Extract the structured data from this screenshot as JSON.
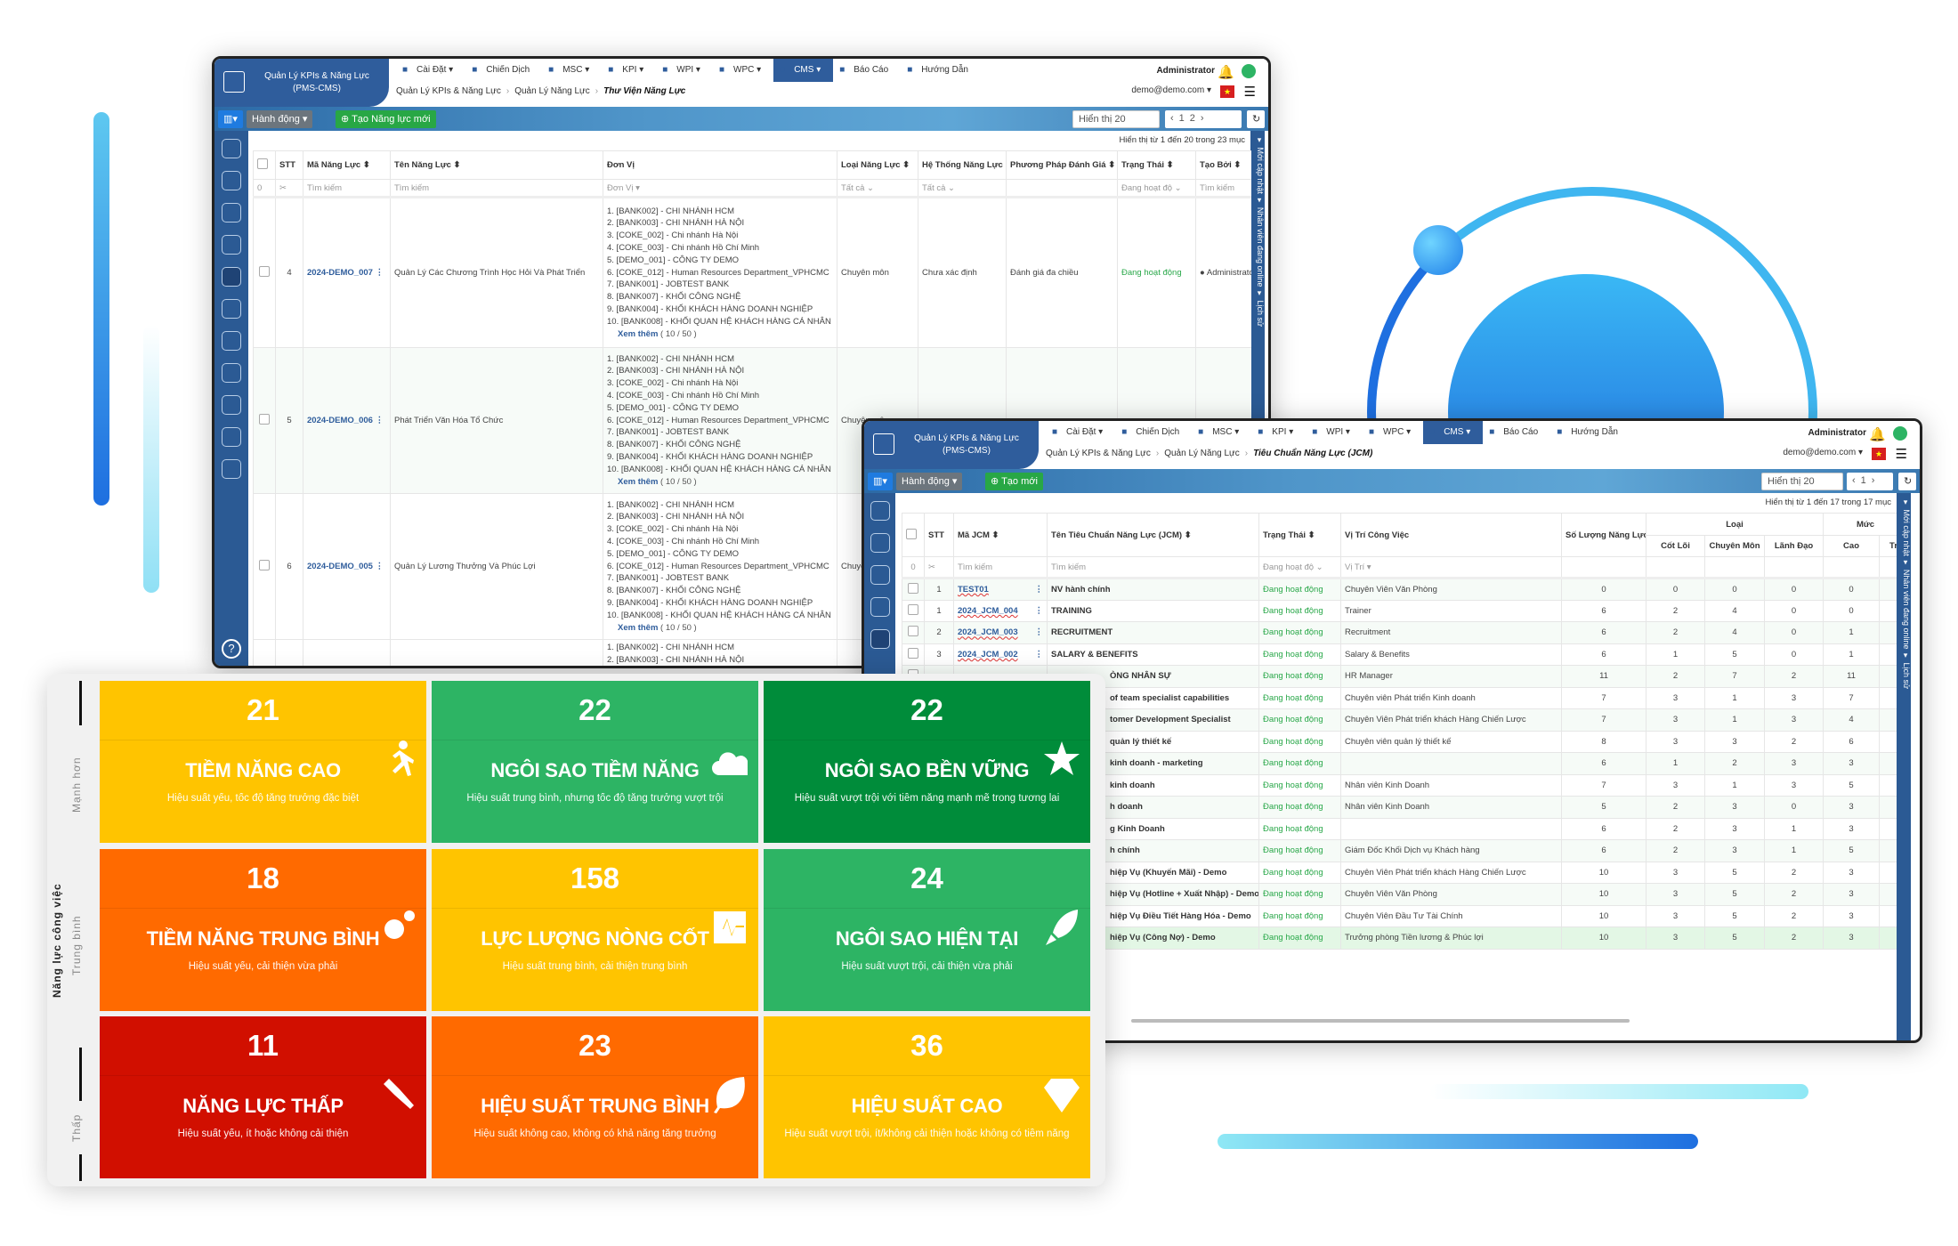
{
  "colors": {
    "brand": "#2f5d9c",
    "active_status": "#2aa84a",
    "yellow": "#ffc400",
    "green": "#2db464",
    "dark_green": "#008c3a",
    "orange": "#ff6a00",
    "red": "#d10f00"
  },
  "app": {
    "brand_line1": "Quản Lý KPIs & Năng Lực",
    "brand_line2": "(PMS-CMS)",
    "menu": [
      {
        "icon": "gear-icon",
        "label": "Cài Đặt ▾"
      },
      {
        "icon": "flag-icon",
        "label": "Chiến Dịch"
      },
      {
        "icon": "file-icon",
        "label": "MSC ▾"
      },
      {
        "icon": "chart-icon",
        "label": "KPI ▾"
      },
      {
        "icon": "tree-icon",
        "label": "WPI ▾"
      },
      {
        "icon": "search-icon",
        "label": "WPC ▾"
      },
      {
        "icon": "trend-icon",
        "label": "CMS ▾"
      },
      {
        "icon": "report-icon",
        "label": "Báo Cáo"
      },
      {
        "icon": "book-icon",
        "label": "Hướng Dẫn"
      }
    ],
    "user": "Administrator",
    "email": "demo@demo.com ▾",
    "flag": "★"
  },
  "back": {
    "breadcrumb": [
      "Quản Lý KPIs & Năng Lực",
      "Quản Lý Năng Lực",
      "Thư Viện Năng Lực"
    ],
    "actions": "Hành động ▾",
    "create": "Tạo Năng lực mới",
    "page_size": "Hiển thị 20",
    "pages": [
      "‹",
      "1",
      "2",
      "›"
    ],
    "info": "Hiển thị từ 1 đến 20 trong 23 mục",
    "side_tabs": "▾ Mới cập nhật   ▾ Nhân viên đang online   ▾ Lịch sử",
    "columns": [
      "",
      "STT",
      "Mã Năng Lực ⬍",
      "Tên Năng Lực ⬍",
      "Đơn Vị",
      "Loại Năng Lực ⬍",
      "Hệ Thống Năng Lực",
      "Phương Pháp Đánh Giá ⬍",
      "Trạng Thái ⬍",
      "Tạo Bởi ⬍"
    ],
    "filters": [
      "0",
      "",
      "Tìm kiếm",
      "Tìm kiếm",
      "Đơn Vị ▾",
      "Tất cả ⌄",
      "Tất cả ⌄",
      "",
      "Đang hoạt độ ⌄",
      "Tìm kiếm"
    ],
    "units": [
      "1. [BANK002] - CHI NHÁNH HCM",
      "2. [BANK003] - CHI NHÁNH HÀ NỘI",
      "3. [COKE_002] - Chi nhánh Hà Nội",
      "4. [COKE_003] - Chi nhánh Hồ Chí Minh",
      "5. [DEMO_001] - CÔNG TY DEMO",
      "6. [COKE_012] - Human Resources Department_VPHCMC",
      "7. [BANK001] - JOBTEST BANK",
      "8. [BANK007] - KHỐI CÔNG NGHỆ",
      "9. [BANK004] - KHỐI KHÁCH HÀNG DOANH NGHIỆP",
      "10. [BANK008] - KHỐI QUAN HỆ KHÁCH HÀNG CÁ NHÂN"
    ],
    "see_more": "Xem thêm",
    "see_more_count": "( 10 / 50 )",
    "rows": [
      {
        "stt": "4",
        "code": "2024-DEMO_007",
        "name": "Quản Lý Các Chương Trình Học Hỏi Và Phát Triển",
        "type": "Chuyên môn",
        "system": "Chưa xác định",
        "method": "Đánh giá đa chiều",
        "status": "Đang hoạt động",
        "creator": "Administrator"
      },
      {
        "stt": "5",
        "code": "2024-DEMO_006",
        "name": "Phát Triển Văn Hóa Tổ Chức",
        "type": "Chuyên môn"
      },
      {
        "stt": "6",
        "code": "2024-DEMO_005",
        "name": "Quản Lý Lương Thưởng Và Phúc Lợi",
        "type": "Chuyên môn"
      }
    ]
  },
  "front": {
    "breadcrumb": [
      "Quản Lý KPIs & Năng Lực",
      "Quản Lý Năng Lực",
      "Tiêu Chuẩn Năng Lực (JCM)"
    ],
    "actions": "Hành động ▾",
    "create": "Tạo mới",
    "page_size": "Hiển thị 20",
    "pages": [
      "‹",
      "1",
      "›"
    ],
    "info": "Hiển thị từ 1 đến 17 trong 17 mục",
    "side_tabs": "▾ Mới cập nhật   ▾ Nhân viên đang online   ▾ Lịch sử",
    "columns": {
      "stt": "STT",
      "code": "Mã JCM ⬍",
      "name": "Tên Tiêu Chuẩn Năng Lực (JCM) ⬍",
      "status": "Trạng Thái ⬍",
      "position": "Vị Trí Công Việc",
      "count": "Số Lượng Năng Lực",
      "group_type": "Loại",
      "group_level": "Mức",
      "core": "Cốt Lõi",
      "expert": "Chuyên Môn",
      "lead": "Lãnh Đạo",
      "high": "Cao",
      "next": "Tr"
    },
    "filters": {
      "count": "0",
      "code": "Tìm kiếm",
      "name": "Tìm kiếm",
      "status": "Đang hoạt độ ⌄",
      "position": "Vị Trí ▾"
    },
    "rows": [
      {
        "stt": "1",
        "code": "TEST01",
        "name": "NV hành chính",
        "status": "Đang hoạt động",
        "position": "Chuyên Viên Văn Phòng",
        "v": [
          "0",
          "0",
          "0",
          "0",
          "0"
        ]
      },
      {
        "stt": "1",
        "code": "2024_JCM_004",
        "name": "TRAINING",
        "status": "Đang hoạt động",
        "position": "Trainer",
        "v": [
          "6",
          "2",
          "4",
          "0",
          "0"
        ]
      },
      {
        "stt": "2",
        "code": "2024_JCM_003",
        "name": "RECRUITMENT",
        "status": "Đang hoạt động",
        "position": "Recruitment",
        "v": [
          "6",
          "2",
          "4",
          "0",
          "1"
        ]
      },
      {
        "stt": "3",
        "code": "2024_JCM_002",
        "name": "SALARY & BENEFITS",
        "status": "Đang hoạt động",
        "position": "Salary & Benefits",
        "v": [
          "6",
          "1",
          "5",
          "0",
          "1"
        ]
      },
      {
        "name": "ÒNG NHÂN SỰ",
        "status": "Đang hoạt động",
        "position": "HR Manager",
        "v": [
          "11",
          "2",
          "7",
          "2",
          "11"
        ]
      },
      {
        "name": "of team specialist capabilities",
        "status": "Đang hoạt động",
        "position": "Chuyên viên Phát triển Kinh doanh",
        "v": [
          "7",
          "3",
          "1",
          "3",
          "7"
        ]
      },
      {
        "name": "tomer Development Specialist",
        "status": "Đang hoạt động",
        "position": "Chuyên Viên Phát triển khách Hàng Chiến Lược",
        "v": [
          "7",
          "3",
          "1",
          "3",
          "4"
        ]
      },
      {
        "name": "quản lý thiết kế",
        "status": "Đang hoạt động",
        "position": "Chuyên viên quản lý thiết kế",
        "v": [
          "8",
          "3",
          "3",
          "2",
          "6"
        ]
      },
      {
        "name": "kinh doanh - marketing",
        "status": "Đang hoạt động",
        "position": "",
        "v": [
          "6",
          "1",
          "2",
          "3",
          "3"
        ]
      },
      {
        "name": "kinh doanh",
        "status": "Đang hoạt động",
        "position": "Nhân viên Kinh Doanh",
        "v": [
          "7",
          "3",
          "1",
          "3",
          "5"
        ]
      },
      {
        "name": "h doanh",
        "status": "Đang hoạt động",
        "position": "Nhân viên Kinh Doanh",
        "v": [
          "5",
          "2",
          "3",
          "0",
          "3"
        ]
      },
      {
        "name": "g Kinh Doanh",
        "status": "Đang hoạt động",
        "position": "",
        "v": [
          "6",
          "2",
          "3",
          "1",
          "3"
        ]
      },
      {
        "name": "h chính",
        "status": "Đang hoạt động",
        "position": "Giám Đốc Khối Dịch vụ Khách hàng",
        "v": [
          "6",
          "2",
          "3",
          "1",
          "5"
        ]
      },
      {
        "name": "hiệp Vụ (Khuyến Mãi) - Demo",
        "status": "Đang hoạt động",
        "position": "Chuyên Viên Phát triển khách Hàng Chiến Lược",
        "v": [
          "10",
          "3",
          "5",
          "2",
          "3"
        ]
      },
      {
        "name": "hiệp Vụ (Hotline + Xuất Nhập) - Demo",
        "status": "Đang hoạt động",
        "position": "Chuyên Viên Văn Phòng",
        "v": [
          "10",
          "3",
          "5",
          "2",
          "3"
        ]
      },
      {
        "name": "hiệp Vụ Điều Tiết Hàng Hóa - Demo",
        "status": "Đang hoạt động",
        "position": "Chuyên Viên Đầu Tư Tài Chính",
        "v": [
          "10",
          "3",
          "5",
          "2",
          "3"
        ]
      },
      {
        "name": "hiệp Vụ (Công Nợ) - Demo",
        "status": "Đang hoạt động",
        "position": "Trưởng phòng Tiền lương & Phúc lợi",
        "v": [
          "10",
          "3",
          "5",
          "2",
          "3"
        ],
        "highlight": true
      }
    ]
  },
  "ninebox": {
    "y_axis_title": "Năng lực công việc",
    "y_levels": [
      "Mạnh hơn",
      "Trung bình",
      "Thấp"
    ],
    "cells": [
      {
        "count": "21",
        "title": "TIỀM NĂNG CAO",
        "desc": "Hiệu suất yếu, tốc độ tăng trưởng đặc biệt",
        "color": "#ffc400",
        "icon": "running-icon"
      },
      {
        "count": "22",
        "title": "NGÔI SAO TIỀM NĂNG",
        "desc": "Hiệu suất trung bình, nhưng tốc độ tăng trưởng vượt trội",
        "color": "#2db464",
        "icon": "cloud-icon"
      },
      {
        "count": "22",
        "title": "NGÔI SAO BỀN VỮNG",
        "desc": "Hiệu suất vượt trội với tiềm năng mạnh mẽ trong tương lai",
        "color": "#008c3a",
        "icon": "star-icon"
      },
      {
        "count": "18",
        "title": "TIỀM NĂNG TRUNG BÌNH",
        "desc": "Hiệu suất yếu, cải thiện vừa phải",
        "color": "#ff6a00",
        "icon": "gears-icon"
      },
      {
        "count": "158",
        "title": "LỰC LƯỢNG NÒNG CỐT",
        "desc": "Hiệu suất trung bình, cải thiện trung bình",
        "color": "#ffc400",
        "icon": "heartbeat-icon"
      },
      {
        "count": "24",
        "title": "NGÔI SAO HIỆN TẠI",
        "desc": "Hiệu suất vượt trội, cải thiện vừa phải",
        "color": "#2db464",
        "icon": "rocket-icon"
      },
      {
        "count": "11",
        "title": "NĂNG LỰC THẤP",
        "desc": "Hiệu suất yếu, ít hoặc không cải thiện",
        "color": "#d10f00",
        "icon": "gavel-icon"
      },
      {
        "count": "23",
        "title": "HIỆU SUẤT TRUNG BÌNH",
        "desc": "Hiệu suất không cao, không có khả năng tăng trưởng",
        "color": "#ff6a00",
        "icon": "leaf-icon"
      },
      {
        "count": "36",
        "title": "HIỆU SUẤT CAO",
        "desc": "Hiệu suất vượt trội, ít/không cải thiện hoặc không có tiềm năng",
        "color": "#ffc400",
        "icon": "diamond-icon"
      }
    ]
  }
}
